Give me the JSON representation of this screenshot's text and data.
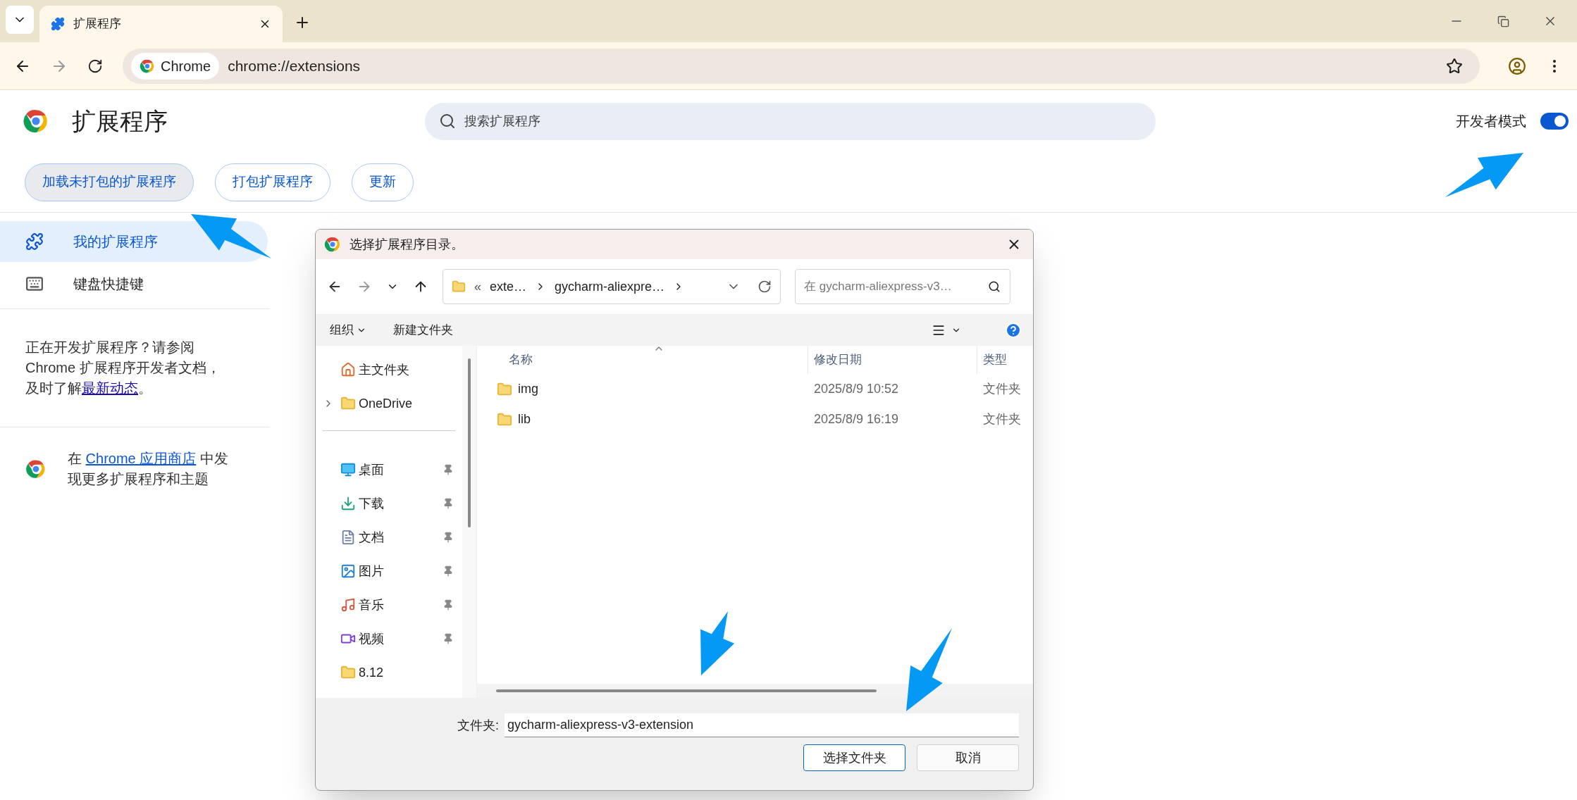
{
  "browser": {
    "tabs": [
      {
        "title": "扩展程序",
        "selected": true
      }
    ],
    "address": {
      "chip": "Chrome",
      "url": "chrome://extensions"
    }
  },
  "header": {
    "title": "扩展程序",
    "search": {
      "placeholder": "搜索扩展程序"
    },
    "developer_mode": {
      "label": "开发者模式",
      "on": true
    }
  },
  "actions": [
    {
      "label": "加载未打包的扩展程序",
      "selected": true
    },
    {
      "label": "打包扩展程序",
      "selected": false
    },
    {
      "label": "更新",
      "selected": false
    }
  ],
  "sidebar": {
    "items": [
      {
        "label": "我的扩展程序",
        "kind": "puzzle",
        "selected": true
      },
      {
        "label": "键盘快捷键",
        "kind": "keyboard",
        "selected": false
      }
    ],
    "dev_note": {
      "before": "正在开发扩展程序？请参阅 Chrome 扩展程序开发者文档，及时了解",
      "link": "最新动态",
      "after": "。"
    },
    "store_note": {
      "before": "在 ",
      "link": "Chrome 应用商店",
      "after": " 中发现更多扩展程序和主题"
    }
  },
  "dialog": {
    "title": "选择扩展程序目录。",
    "breadcrumb": {
      "overflow": "«",
      "parts": [
        "exte…",
        "gycharm-aliexpre…"
      ]
    },
    "search": {
      "placeholder": "在 gycharm-aliexpress-v3…"
    },
    "toolbar": [
      {
        "label": "组织",
        "dropdown": true
      },
      {
        "label": "新建文件夹",
        "dropdown": false
      }
    ],
    "nav": [
      {
        "label": "主文件夹",
        "kind": "home",
        "expandable": false,
        "pinned": false
      },
      {
        "label": "OneDrive",
        "kind": "folder",
        "expandable": true,
        "pinned": false
      },
      {
        "kind": "separator"
      },
      {
        "label": "桌面",
        "kind": "desktop",
        "expandable": false,
        "pinned": true
      },
      {
        "label": "下载",
        "kind": "download",
        "expandable": false,
        "pinned": true
      },
      {
        "label": "文档",
        "kind": "document",
        "expandable": false,
        "pinned": true
      },
      {
        "label": "图片",
        "kind": "pictures",
        "expandable": false,
        "pinned": true
      },
      {
        "label": "音乐",
        "kind": "music",
        "expandable": false,
        "pinned": true
      },
      {
        "label": "视频",
        "kind": "video",
        "expandable": false,
        "pinned": true
      },
      {
        "label": "8.12",
        "kind": "folder",
        "expandable": false,
        "pinned": false
      }
    ],
    "columns": [
      "名称",
      "修改日期",
      "类型"
    ],
    "rows": [
      {
        "name": "img",
        "modified": "2025/8/9 10:52",
        "type": "文件夹"
      },
      {
        "name": "lib",
        "modified": "2025/8/9 16:19",
        "type": "文件夹"
      }
    ],
    "folder_field": {
      "label": "文件夹:",
      "value": "gycharm-aliexpress-v3-extension"
    },
    "buttons": [
      {
        "label": "选择文件夹",
        "kind": "primary"
      },
      {
        "label": "取消",
        "kind": "secondary"
      }
    ]
  }
}
